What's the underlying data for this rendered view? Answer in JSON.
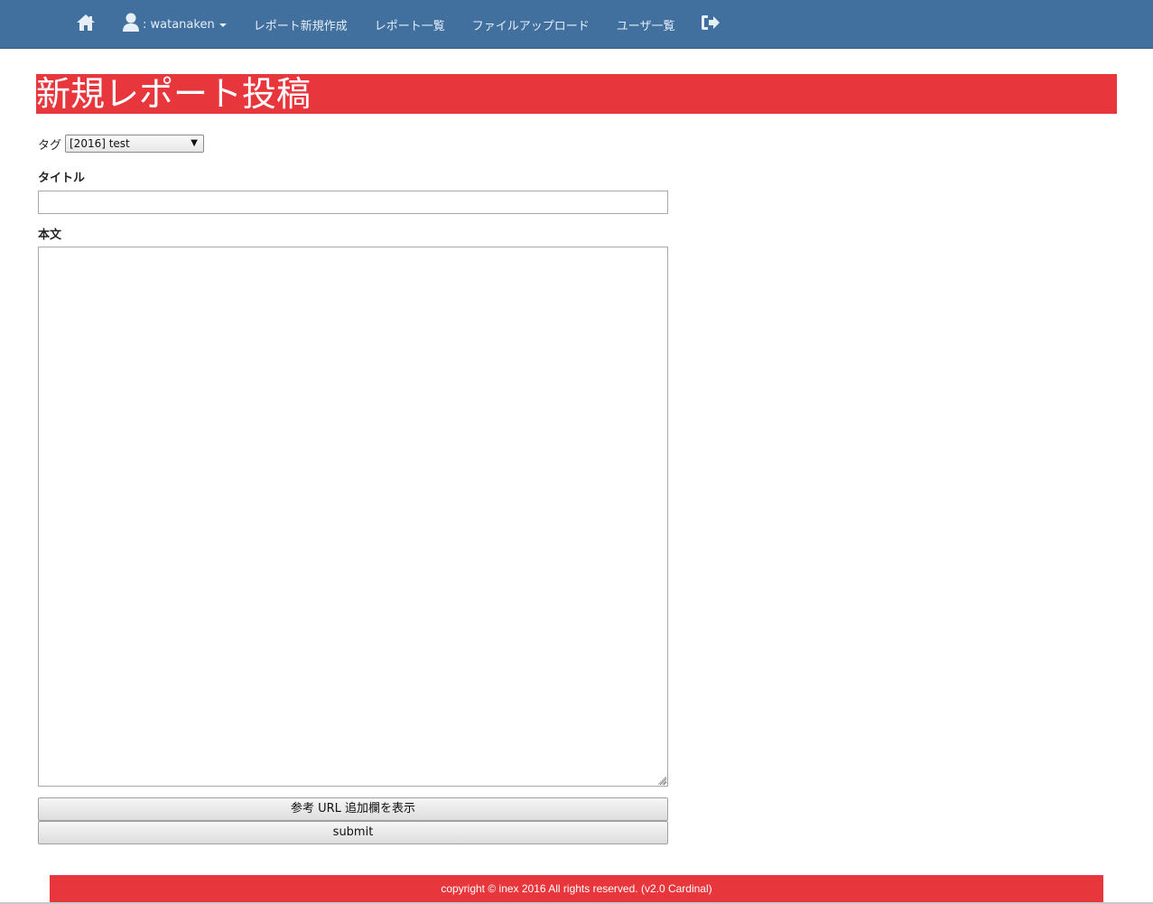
{
  "navbar": {
    "home_icon": "home-icon",
    "user_icon": "user-icon",
    "user_label": ": watanaken",
    "links": [
      {
        "label": "レポート新規作成"
      },
      {
        "label": "レポート一覧"
      },
      {
        "label": "ファイルアップロード"
      },
      {
        "label": "ユーザ一覧"
      }
    ],
    "logout_icon": "logout-icon",
    "background_color": "#41709f"
  },
  "page": {
    "title": "新規レポート投稿",
    "accent_color": "#e8363d"
  },
  "form": {
    "tag_label": "タグ",
    "tag_selected": "[2016] test",
    "title_label": "タイトル",
    "title_value": "",
    "body_label": "本文",
    "body_value": "",
    "show_url_button": "参考 URL 追加欄を表示",
    "submit_button": "submit"
  },
  "footer": {
    "text": "copyright © inex 2016 All rights reserved. (v2.0 Cardinal)"
  }
}
